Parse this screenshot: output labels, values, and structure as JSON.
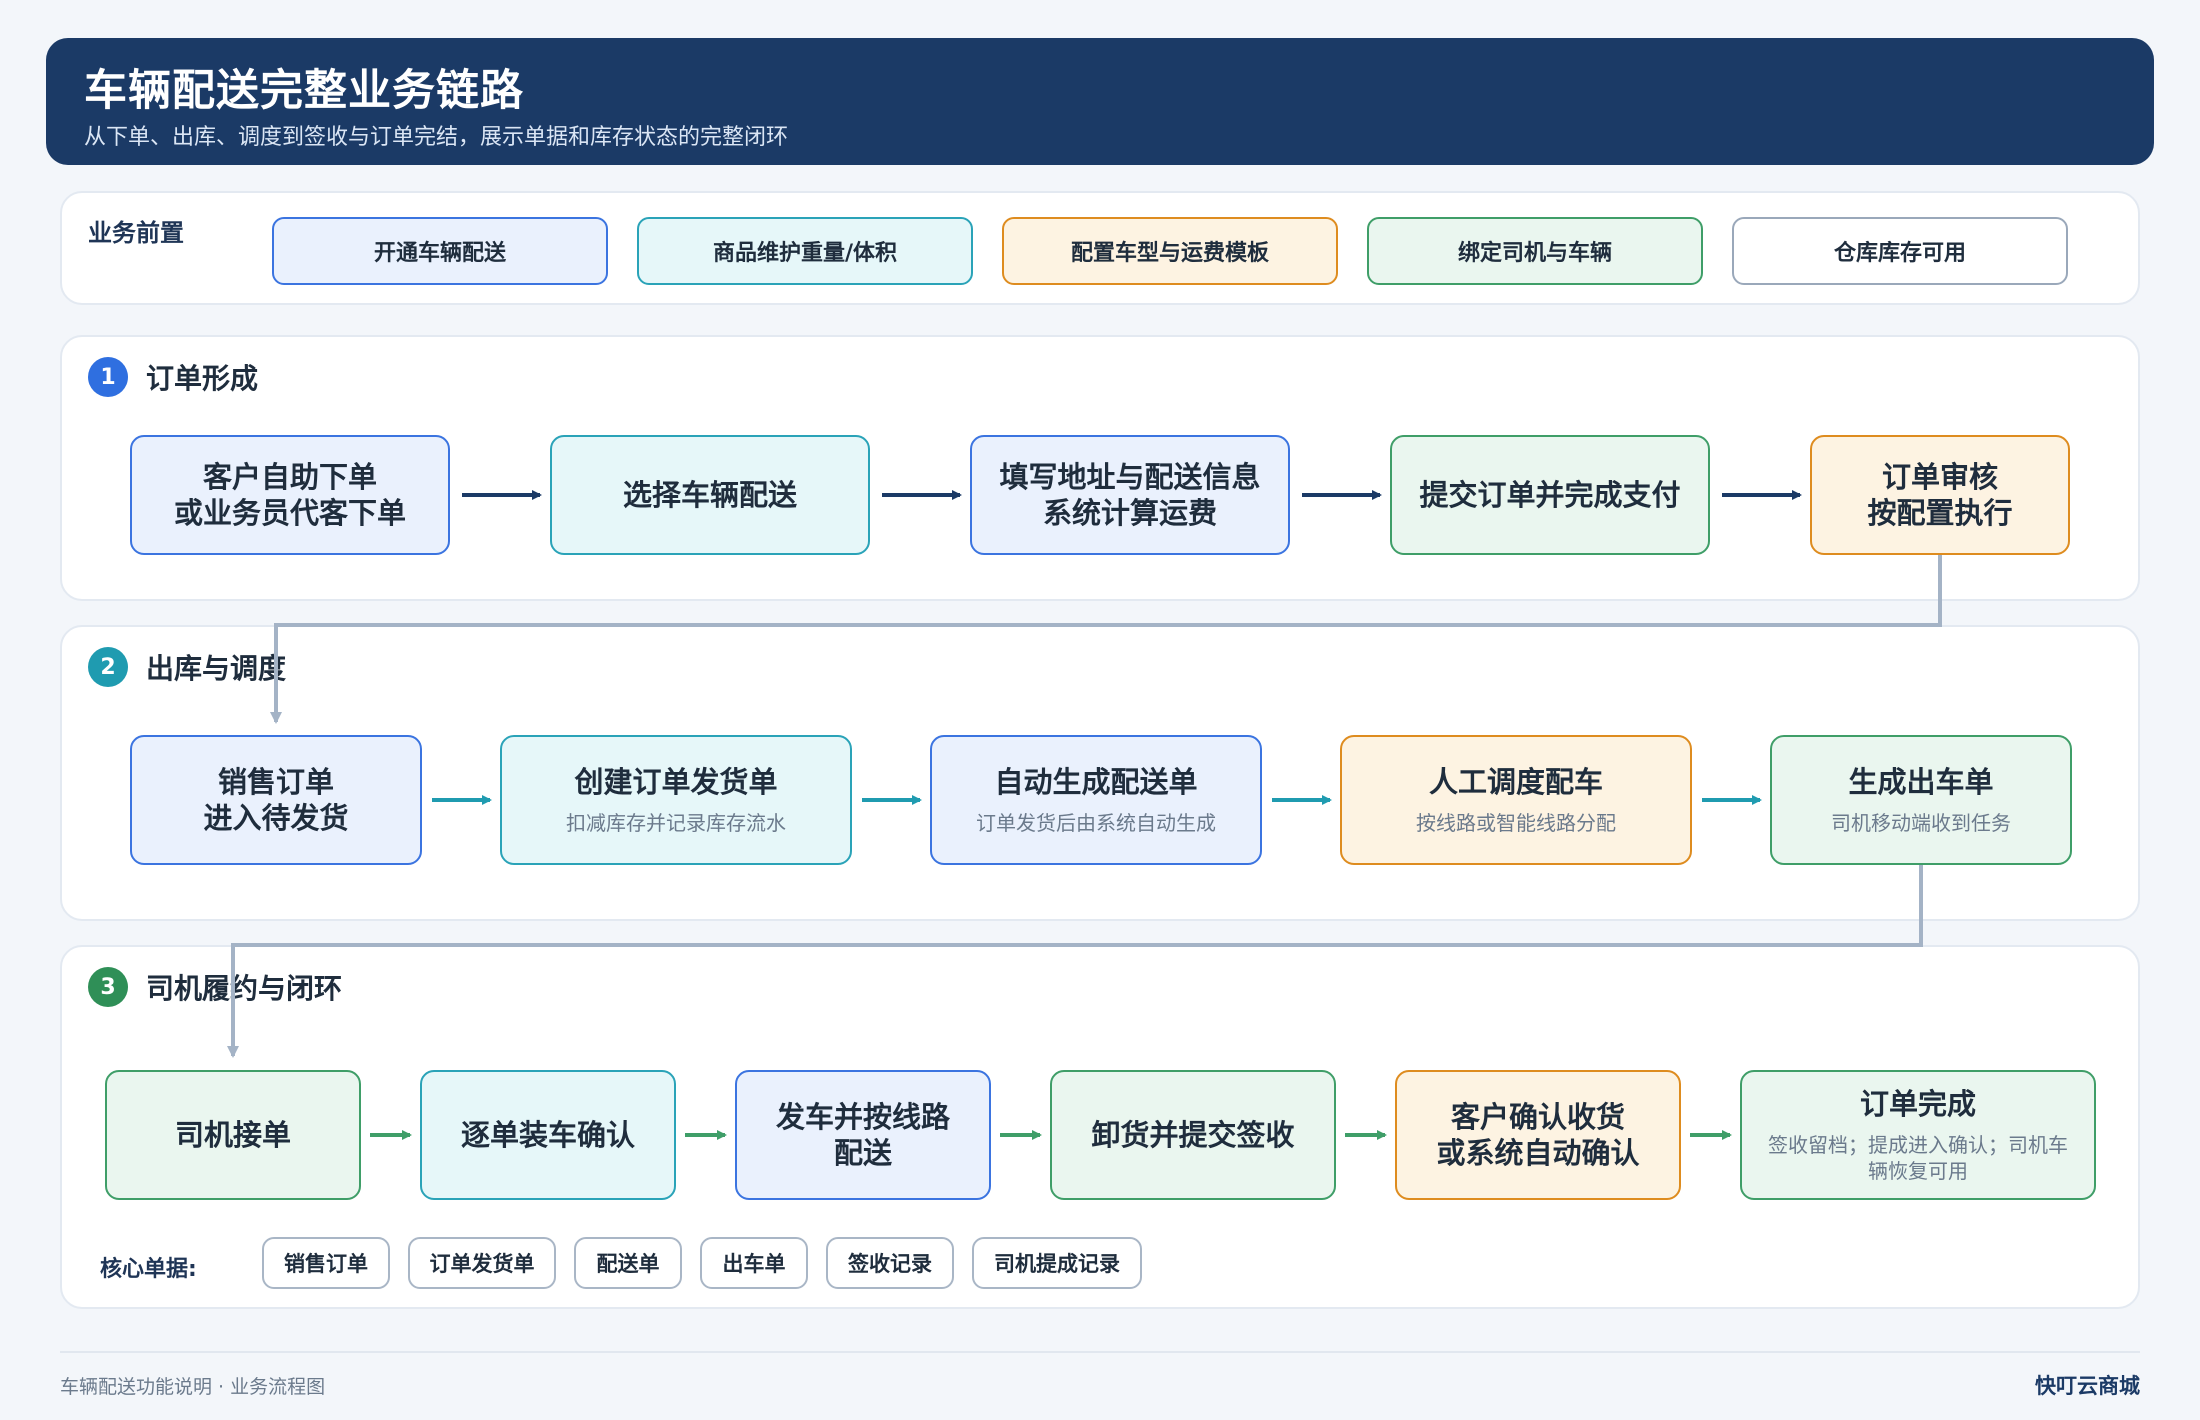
{
  "header": {
    "title": "车辆配送完整业务链路",
    "subtitle": "从下单、出库、调度到签收与订单完结，展示单据和库存状态的完整闭环"
  },
  "prereq": {
    "title": "业务前置",
    "items": [
      "开通车辆配送",
      "商品维护重量/体积",
      "配置车型与运费模板",
      "绑定司机与车辆",
      "仓库库存可用"
    ]
  },
  "stage1": {
    "number": "1",
    "title": "订单形成",
    "nodes": [
      {
        "main": "客户自助下单\n或业务员代客下单"
      },
      {
        "main": "选择车辆配送"
      },
      {
        "main": "填写地址与配送信息\n系统计算运费"
      },
      {
        "main": "提交订单并完成支付"
      },
      {
        "main": "订单审核\n按配置执行"
      }
    ]
  },
  "stage2": {
    "number": "2",
    "title": "出库与调度",
    "nodes": [
      {
        "main": "销售订单\n进入待发货",
        "note": ""
      },
      {
        "main": "创建订单发货单",
        "note": "扣减库存并记录库存流水"
      },
      {
        "main": "自动生成配送单",
        "note": "订单发货后由系统自动生成"
      },
      {
        "main": "人工调度配车",
        "note": "按线路或智能线路分配"
      },
      {
        "main": "生成出车单",
        "note": "司机移动端收到任务"
      }
    ]
  },
  "stage3": {
    "number": "3",
    "title": "司机履约与闭环",
    "nodes": [
      {
        "main": "司机接单",
        "note": ""
      },
      {
        "main": "逐单装车确认",
        "note": ""
      },
      {
        "main": "发车并按线路配送",
        "note": ""
      },
      {
        "main": "卸货并提交签收",
        "note": ""
      },
      {
        "main": "客户确认收货\n或系统自动确认",
        "note": ""
      },
      {
        "main": "订单完成",
        "note": "签收留档；提成进入确认；司机车辆恢复可用"
      }
    ],
    "docs_label": "核心单据:",
    "docs": [
      "销售订单",
      "订单发货单",
      "配送单",
      "出车单",
      "签收记录",
      "司机提成记录"
    ]
  },
  "footer": {
    "left": "车辆配送功能说明 · 业务流程图",
    "right": "快叮云商城"
  },
  "colors": {
    "header_bg": "#1b3a66",
    "stage1_badge": "#2f6fe0",
    "stage2_badge": "#1f9bb0",
    "stage3_badge": "#2f8f57",
    "arrow_dark": "#1b3a66",
    "arrow_teal": "#1f9bb0",
    "arrow_green": "#3f9e68",
    "connector": "#a4b3c6"
  }
}
